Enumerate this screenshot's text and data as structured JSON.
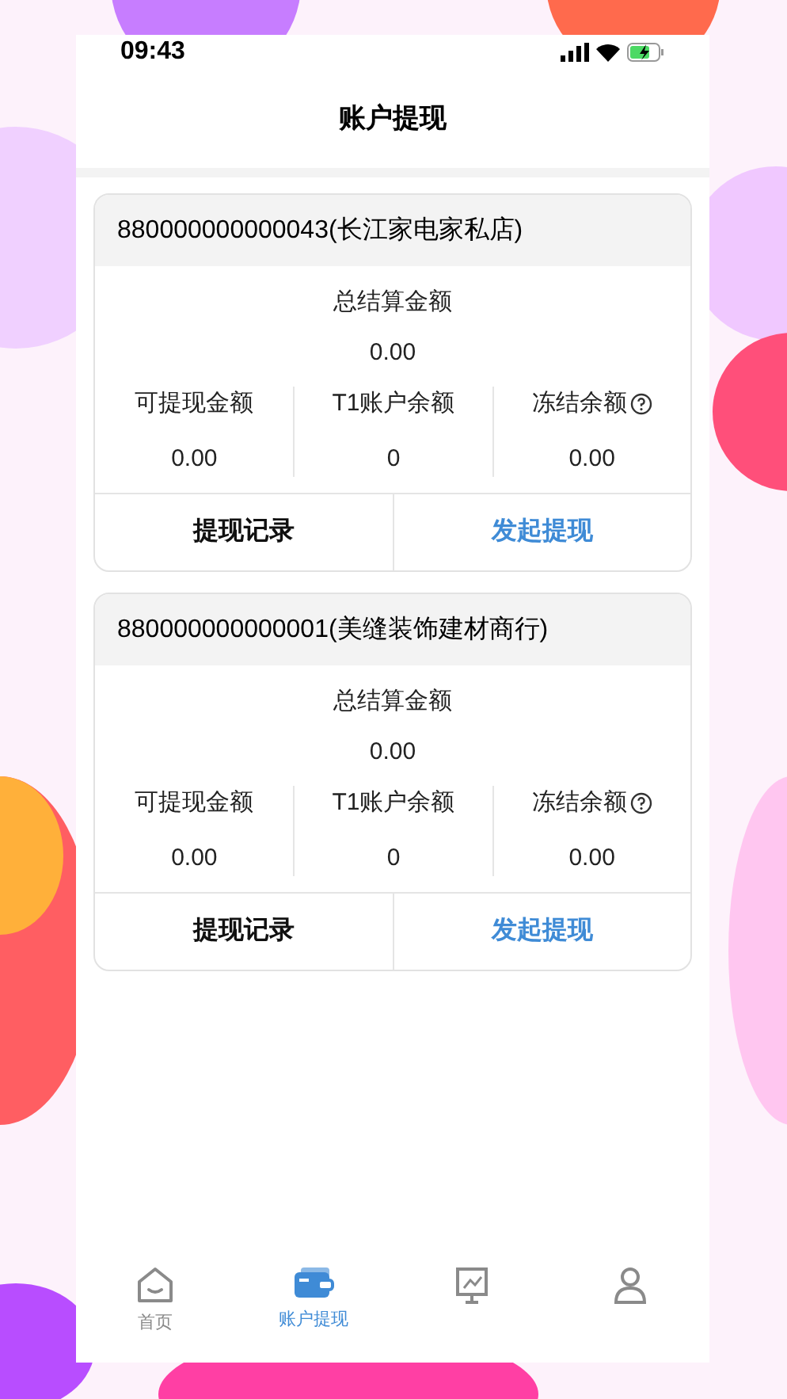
{
  "status_bar": {
    "time": "09:43"
  },
  "header": {
    "title": "账户提现"
  },
  "accounts": [
    {
      "name": "880000000000043(长江家电家私店)",
      "total_label": "总结算金额",
      "total": "0.00",
      "stats": [
        {
          "label": "可提现金额",
          "value": "0.00"
        },
        {
          "label": "T1账户余额",
          "value": "0"
        },
        {
          "label": "冻结余额",
          "value": "0.00",
          "help": true
        }
      ],
      "actions": [
        {
          "label": "提现记录",
          "kind": "plain"
        },
        {
          "label": "发起提现",
          "kind": "primary"
        }
      ]
    },
    {
      "name": "880000000000001(美缝装饰建材商行)",
      "total_label": "总结算金额",
      "total": "0.00",
      "stats": [
        {
          "label": "可提现金额",
          "value": "0.00"
        },
        {
          "label": "T1账户余额",
          "value": "0"
        },
        {
          "label": "冻结余额",
          "value": "0.00",
          "help": true
        }
      ],
      "actions": [
        {
          "label": "提现记录",
          "kind": "plain"
        },
        {
          "label": "发起提现",
          "kind": "primary"
        }
      ]
    }
  ],
  "tab_bar": [
    {
      "kind": "home",
      "label": "首页",
      "selected": false
    },
    {
      "kind": "wallet",
      "label": "账户提现",
      "selected": true
    },
    {
      "kind": "chart",
      "selected": false
    },
    {
      "kind": "user",
      "selected": false
    }
  ]
}
